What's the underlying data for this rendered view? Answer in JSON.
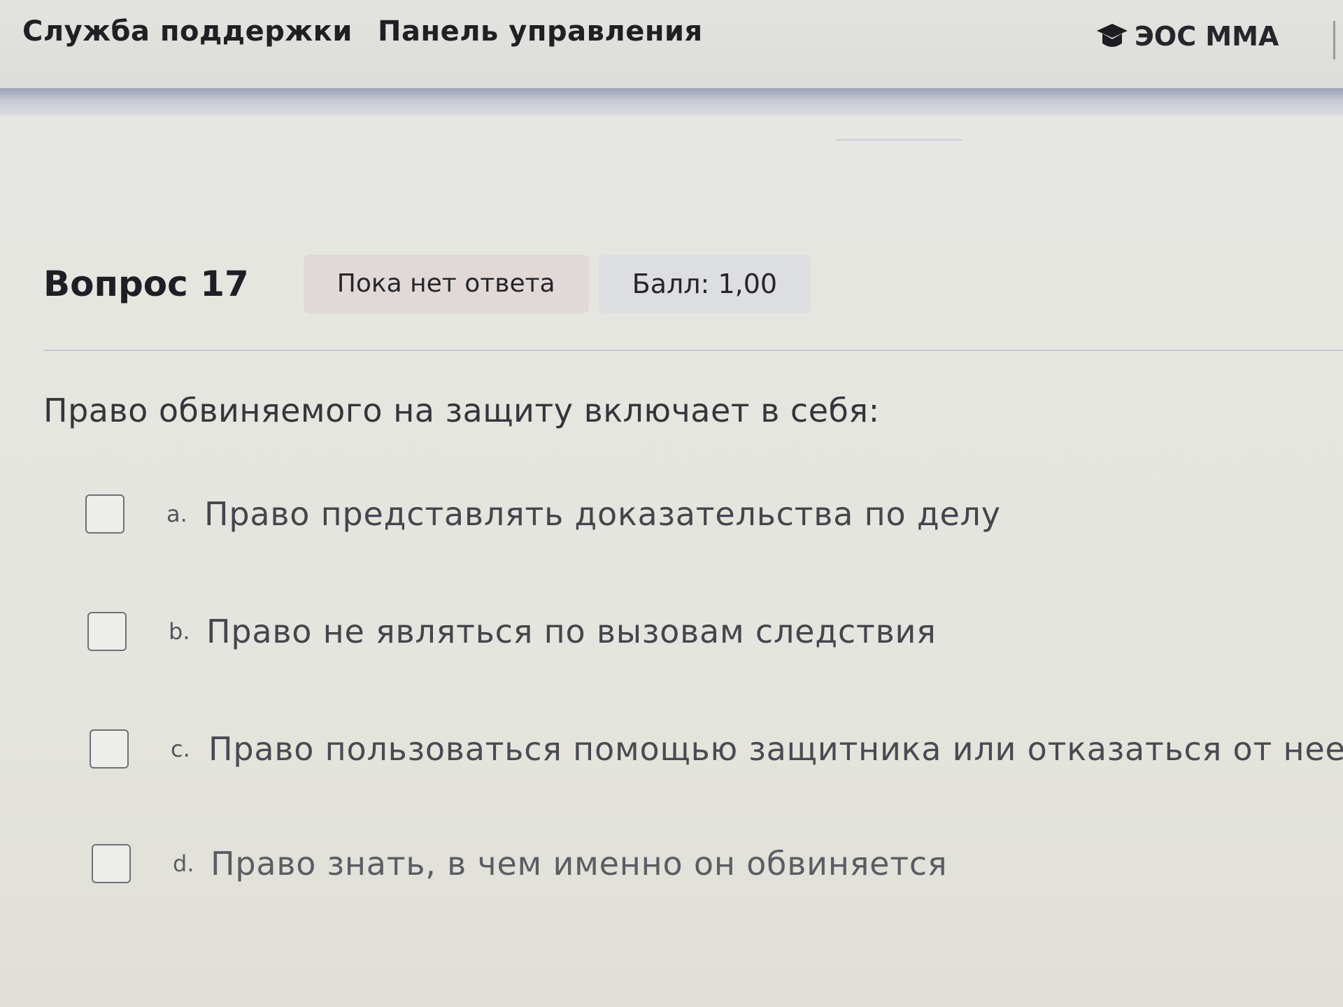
{
  "navbar": {
    "support_label": "Служба поддержки",
    "dashboard_label": "Панель управления",
    "brand_label": "ЭОС ММА",
    "brand_icon": "graduation-cap-icon"
  },
  "question": {
    "title": "Вопрос 17",
    "status": "Пока нет ответа",
    "grade": "Балл: 1,00",
    "text": "Право обвиняемого на защиту включает в себя:",
    "options": [
      {
        "letter": "a.",
        "text": "Право представлять доказательства по делу",
        "checked": false
      },
      {
        "letter": "b.",
        "text": "Право не являться по вызовам следствия",
        "checked": false
      },
      {
        "letter": "c.",
        "text": "Право пользоваться помощью защитника или отказаться от нее",
        "checked": false
      },
      {
        "letter": "d.",
        "text": "Право знать, в чем именно он обвиняется",
        "checked": false
      }
    ]
  }
}
